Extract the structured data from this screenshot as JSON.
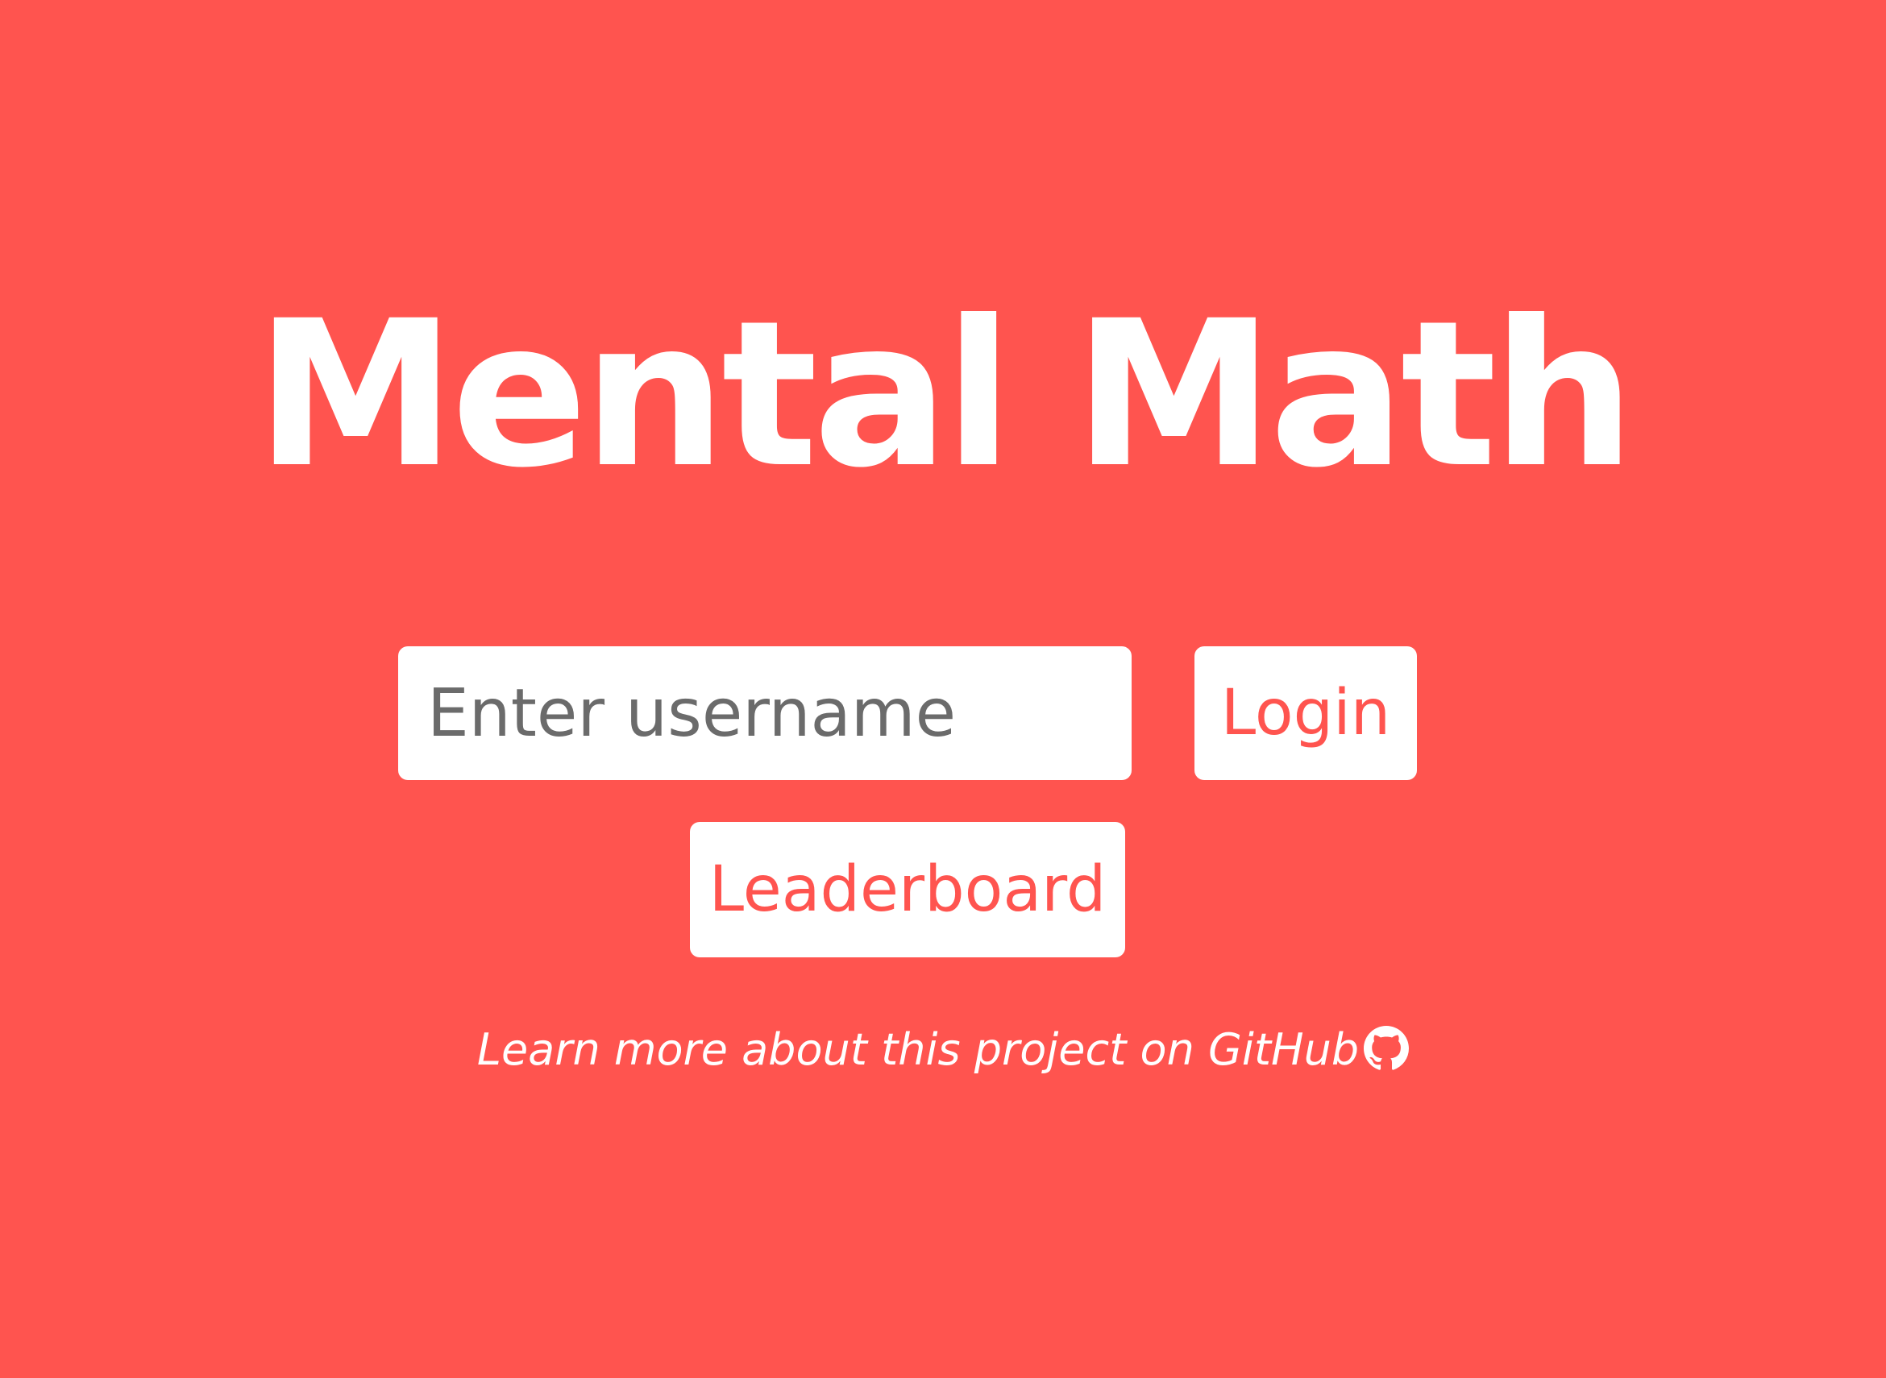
{
  "app": {
    "title": "Mental Math"
  },
  "login_form": {
    "username_placeholder": "Enter username",
    "username_value": "",
    "login_label": "Login"
  },
  "leaderboard": {
    "label": "Leaderboard"
  },
  "footer": {
    "prefix": "Learn more about this project on ",
    "link_text": "GitHub",
    "icon": "github-icon"
  },
  "colors": {
    "background": "#FF544F",
    "foreground": "#FFFFFF",
    "placeholder": "#6B6B6B",
    "button_text": "#FF544F"
  }
}
